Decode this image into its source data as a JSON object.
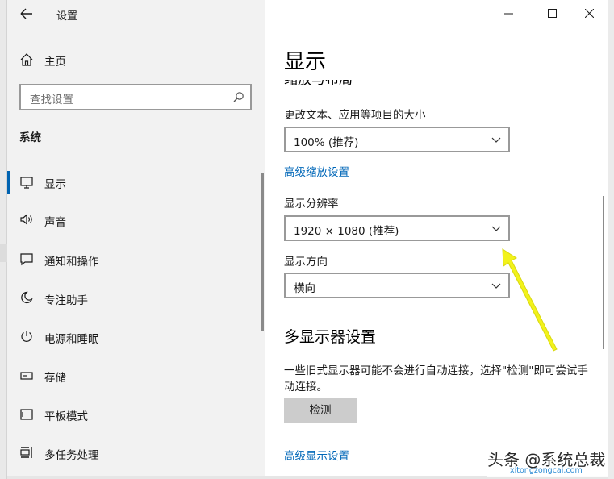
{
  "window": {
    "title": "设置",
    "controls": [
      "minimize",
      "maximize",
      "close"
    ]
  },
  "sidebar": {
    "home_label": "主页",
    "search_placeholder": "查找设置",
    "section_label": "系统",
    "items": [
      {
        "label": "显示",
        "icon": "monitor-icon",
        "active": true
      },
      {
        "label": "声音",
        "icon": "speaker-icon",
        "active": false
      },
      {
        "label": "通知和操作",
        "icon": "notification-icon",
        "active": false
      },
      {
        "label": "专注助手",
        "icon": "moon-icon",
        "active": false
      },
      {
        "label": "电源和睡眠",
        "icon": "power-icon",
        "active": false
      },
      {
        "label": "存储",
        "icon": "storage-icon",
        "active": false
      },
      {
        "label": "平板模式",
        "icon": "tablet-icon",
        "active": false
      },
      {
        "label": "多任务处理",
        "icon": "multitask-icon",
        "active": false
      }
    ]
  },
  "main": {
    "page_title": "显示",
    "scale_heading": "缩放与布局",
    "scale_label": "更改文本、应用等项目的大小",
    "scale_value": "100% (推荐)",
    "advanced_scaling_link": "高级缩放设置",
    "resolution_label": "显示分辨率",
    "resolution_value": "1920 × 1080 (推荐)",
    "orientation_label": "显示方向",
    "orientation_value": "横向",
    "multi_heading": "多显示器设置",
    "multi_desc": "一些旧式显示器可能不会进行自动连接，选择\"检测\"即可尝试手动连接。",
    "detect_button": "检测",
    "advanced_display_link": "高级显示设置"
  },
  "annotation": {
    "arrow_color": "#f2f21a"
  },
  "watermark": {
    "text": "头条 @系统总裁",
    "sub": "xitongzongcai.com"
  },
  "colors": {
    "accent": "#0067b8",
    "active_indicator": "#0063b1",
    "sidebar_bg": "#f2f2f2"
  }
}
